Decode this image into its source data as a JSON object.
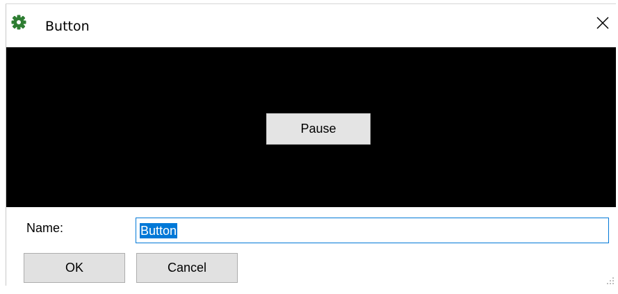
{
  "window": {
    "title": "Button",
    "icon": "gear-icon",
    "close_icon": "close-icon"
  },
  "preview": {
    "background": "#000000",
    "button_label": "Pause"
  },
  "form": {
    "name_label": "Name:",
    "name_value": "Button",
    "ok_label": "OK",
    "cancel_label": "Cancel"
  },
  "colors": {
    "accent": "#0078d7",
    "icon_green": "#2e7d32"
  }
}
